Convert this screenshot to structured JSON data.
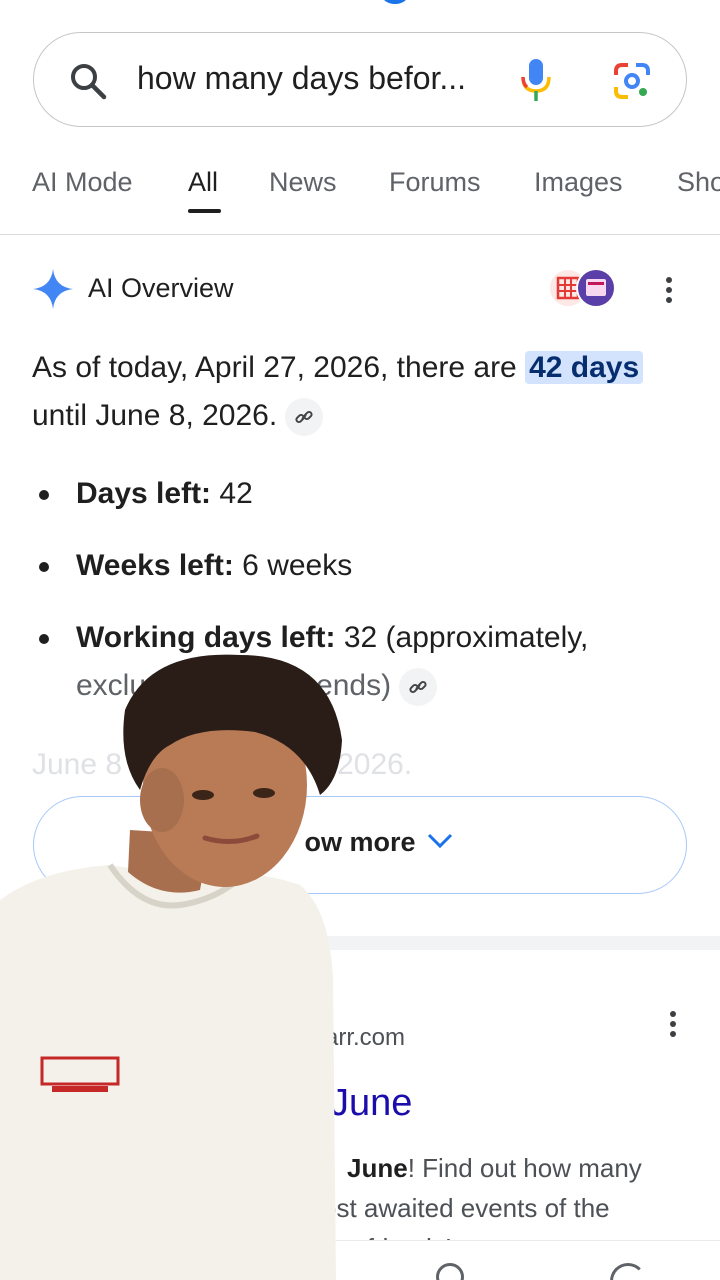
{
  "search": {
    "query": "how many days befor..."
  },
  "tabs": [
    {
      "label": "AI Mode"
    },
    {
      "label": "All"
    },
    {
      "label": "News"
    },
    {
      "label": "Forums"
    },
    {
      "label": "Images"
    },
    {
      "label": "Sho"
    }
  ],
  "ai_overview": {
    "title": "AI Overview",
    "intro": "As of today, April 27, 2026, there are ",
    "highlight": "42 days",
    "intro_end": "until June 8, 2026.",
    "bullets": [
      {
        "label": "Days left:",
        "value": " 42"
      },
      {
        "label": "Weeks left:",
        "value": " 6 weeks"
      },
      {
        "label": "Working days left:",
        "value": " 32 (approximately,"
      }
    ],
    "bullet3_cont": "exclu",
    "bullet3_tail": "ends)",
    "faded_start": "June 8",
    "faded_end": "n 2026.",
    "show_more": "ow more"
  },
  "result": {
    "site": "arr.com",
    "title": "June",
    "snippet_bold": "June",
    "snippet_line1": "! Find out how many",
    "snippet_line2": "ost awaited events of the",
    "snippet_line3": "our friends!"
  },
  "colors": {
    "accent": "#1a73e8",
    "highlight_bg": "#d3e3fd",
    "link": "#1a0dab"
  }
}
